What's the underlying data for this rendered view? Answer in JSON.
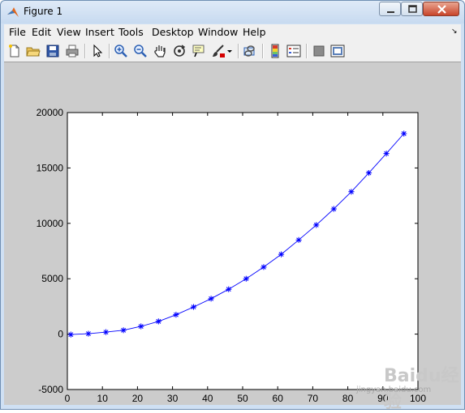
{
  "window": {
    "title": "Figure 1"
  },
  "menu": [
    "File",
    "Edit",
    "View",
    "Insert",
    "Tools",
    "Desktop",
    "Window",
    "Help"
  ],
  "toolbar": {
    "buttons": [
      "new-figure-icon",
      "open-file-icon",
      "save-icon",
      "print-icon",
      "edit-plot-arrow-icon",
      "zoom-in-icon",
      "zoom-out-icon",
      "pan-hand-icon",
      "rotate-3d-icon",
      "data-cursor-icon",
      "brush-icon",
      "brush-dropdown-icon",
      "link-plot-icon",
      "colorbar-icon",
      "legend-icon",
      "hide-plot-tools-icon",
      "show-plot-tools-icon"
    ]
  },
  "colors": {
    "series": "#0000ff",
    "figure_bg": "#cccccc",
    "axes_bg": "#ffffff"
  },
  "chart_data": {
    "type": "line",
    "marker": "asterisk",
    "xlim": [
      0,
      100
    ],
    "ylim": [
      -5000,
      20000
    ],
    "xticks": [
      0,
      10,
      20,
      30,
      40,
      50,
      60,
      70,
      80,
      90,
      100
    ],
    "yticks": [
      -5000,
      0,
      5000,
      10000,
      15000,
      20000
    ],
    "xticklabels": [
      "0",
      "10",
      "20",
      "30",
      "40",
      "50",
      "60",
      "70",
      "80",
      "90",
      "100"
    ],
    "yticklabels": [
      "-5000",
      "0",
      "5000",
      "10000",
      "15000",
      "20000"
    ],
    "grid": false,
    "series": [
      {
        "x": [
          1,
          6,
          11,
          16,
          21,
          26,
          31,
          36,
          41,
          46,
          51,
          56,
          61,
          66,
          71,
          76,
          81,
          86,
          91,
          96
        ],
        "y": [
          -40,
          40,
          180,
          350,
          700,
          1150,
          1750,
          2450,
          3200,
          4050,
          5000,
          6050,
          7200,
          8500,
          9850,
          11300,
          12850,
          14550,
          16300,
          18100
        ]
      }
    ]
  },
  "watermark": {
    "main": "Baidu经验",
    "sub": "jingyan.baidu.com"
  }
}
